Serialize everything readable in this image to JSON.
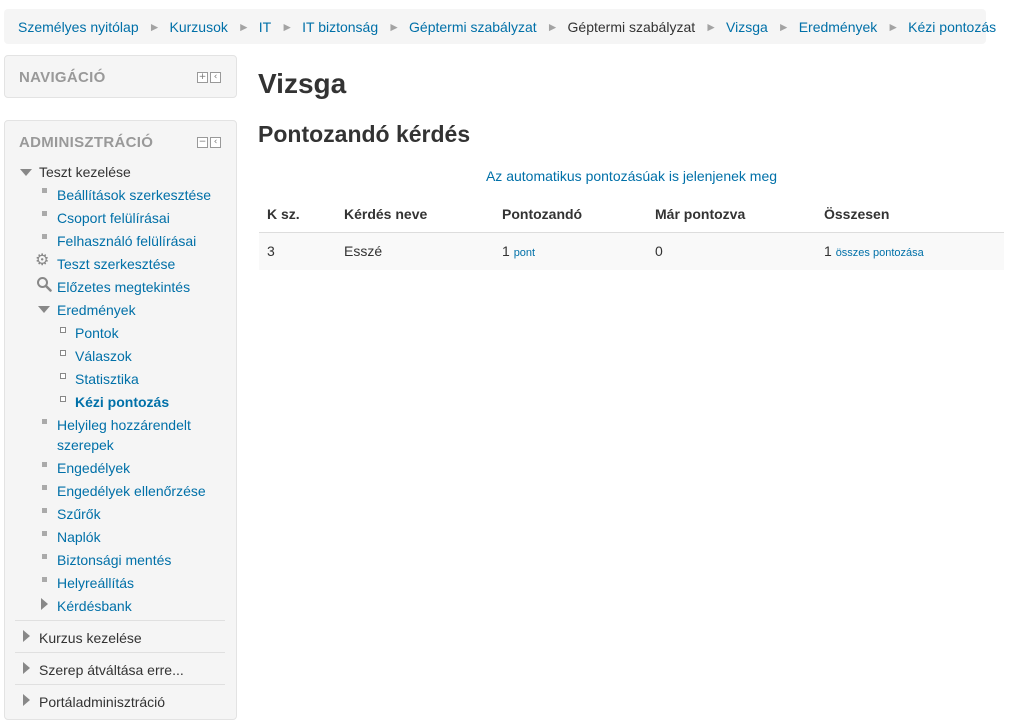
{
  "breadcrumb": [
    {
      "label": "Személyes nyitólap",
      "link": true
    },
    {
      "label": "Kurzusok",
      "link": true
    },
    {
      "label": "IT",
      "link": true
    },
    {
      "label": "IT biztonság",
      "link": true
    },
    {
      "label": "Géptermi szabályzat",
      "link": true
    },
    {
      "label": "Géptermi szabályzat",
      "link": false
    },
    {
      "label": "Vizsga",
      "link": true
    },
    {
      "label": "Eredmények",
      "link": true
    },
    {
      "label": "Kézi pontozás",
      "link": true
    }
  ],
  "nav_block": {
    "title": "NAVIGÁCIÓ"
  },
  "admin_block": {
    "title": "ADMINISZTRÁCIÓ",
    "quiz_admin": "Teszt kezelése",
    "items": {
      "settings": "Beállítások szerkesztése",
      "group_overrides": "Csoport felülírásai",
      "user_overrides": "Felhasználó felülírásai",
      "edit_quiz": "Teszt szerkesztése",
      "preview": "Előzetes megtekintés",
      "results": "Eredmények",
      "grades": "Pontok",
      "responses": "Válaszok",
      "statistics": "Statisztika",
      "manual_grading": "Kézi pontozás",
      "local_roles_1": "Helyileg hozzárendelt",
      "local_roles_2": "szerepek",
      "permissions": "Engedélyek",
      "check_permissions": "Engedélyek ellenőrzése",
      "filters": "Szűrők",
      "logs": "Naplók",
      "backup": "Biztonsági mentés",
      "restore": "Helyreállítás",
      "question_bank": "Kérdésbank"
    },
    "course_admin": "Kurzus kezelése",
    "switch_role": "Szerep átváltása erre...",
    "site_admin": "Portáladminisztráció"
  },
  "main": {
    "title": "Vizsga",
    "subtitle": "Pontozandó kérdés",
    "show_auto_link": "Az automatikus pontozásúak is jelenjenek meg",
    "table": {
      "headers": [
        "K sz.",
        "Kérdés neve",
        "Pontozandó",
        "Már pontozva",
        "Összesen"
      ],
      "rows": [
        {
          "slot": "3",
          "name": "Esszé",
          "to_grade": "1",
          "to_grade_link": "pont",
          "already_graded": "0",
          "total": "1",
          "total_link": "összes pontozása"
        }
      ]
    }
  }
}
